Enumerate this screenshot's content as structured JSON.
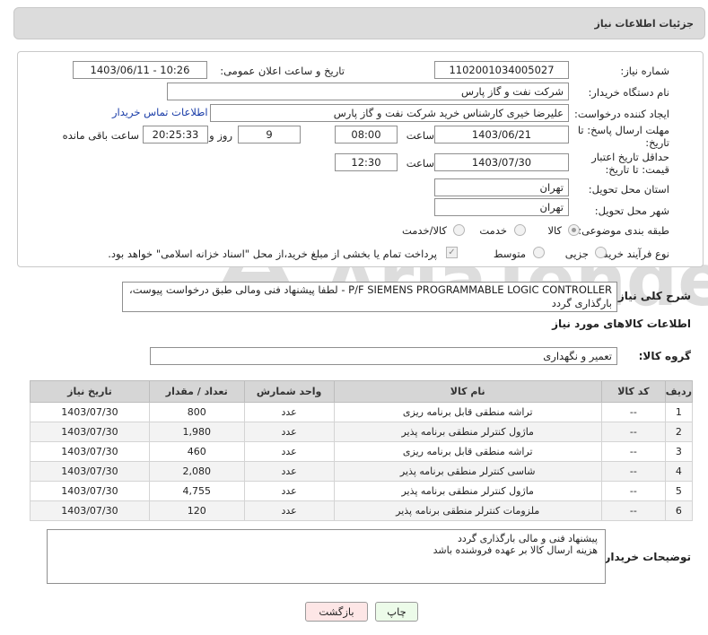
{
  "header": {
    "title": "جزئیات اطلاعات نیاز"
  },
  "form": {
    "need_number_label": "شماره نیاز:",
    "need_number": "1102001034005027",
    "announce_label": "تاریخ و ساعت اعلان عمومی:",
    "announce_value": "1403/06/11 - 10:26",
    "buyer_org_label": "نام دستگاه خریدار:",
    "buyer_org": "شرکت نفت و گاز پارس",
    "requester_label": "ایجاد کننده درخواست:",
    "requester": "علیرضا  خیری کارشناس خرید   شرکت نفت و گاز پارس",
    "contact_link": "اطلاعات تماس خریدار",
    "reply_deadline_label": "مهلت ارسال پاسخ: تا تاریخ:",
    "reply_date": "1403/06/21",
    "time_label": "ساعت",
    "reply_time": "08:00",
    "days_value": "9",
    "days_label": "روز و",
    "remaining_time": "20:25:33",
    "remaining_label": "ساعت باقی مانده",
    "price_validity_label": "حداقل تاریخ اعتبار قیمت: تا تاریخ:",
    "price_date": "1403/07/30",
    "price_time": "12:30",
    "province_label": "استان محل تحویل:",
    "province": "تهران",
    "city_label": "شهر محل تحویل:",
    "city": "تهران",
    "category_label": "طبقه بندی موضوعی:",
    "category_options": [
      "کالا",
      "خدمت",
      "کالا/خدمت"
    ],
    "process_label": "نوع فرآیند خرید :",
    "process_options": [
      "جزیی",
      "متوسط"
    ],
    "payment_note": "پرداخت تمام یا بخشی از مبلغ خرید،از محل \"اسناد خزانه اسلامی\" خواهد بود."
  },
  "summary": {
    "label": "شرح کلی نیاز:",
    "text": "P/F SIEMENS PROGRAMMABLE LOGIC CONTROLLER - لطفا پیشنهاد فنی ومالی طبق درخواست پیوست، بارگذاری گردد"
  },
  "goods_section": {
    "title": "اطلاعات کالاهای مورد نیاز",
    "group_label": "گروه کالا:",
    "group_value": "تعمیر و نگهداری"
  },
  "table": {
    "headers": [
      "ردیف",
      "کد کالا",
      "نام کالا",
      "واحد شمارش",
      "تعداد / مقدار",
      "تاریخ نیاز"
    ],
    "rows": [
      [
        "1",
        "--",
        "تراشه منطقی قابل برنامه ریزی",
        "عدد",
        "800",
        "1403/07/30"
      ],
      [
        "2",
        "--",
        "ماژول کنترلر منطقی برنامه پذیر",
        "عدد",
        "1,980",
        "1403/07/30"
      ],
      [
        "3",
        "--",
        "تراشه منطقی قابل برنامه ریزی",
        "عدد",
        "460",
        "1403/07/30"
      ],
      [
        "4",
        "--",
        "شاسی کنترلر منطقی برنامه پذیر",
        "عدد",
        "2,080",
        "1403/07/30"
      ],
      [
        "5",
        "--",
        "ماژول کنترلر منطقی برنامه پذیر",
        "عدد",
        "4,755",
        "1403/07/30"
      ],
      [
        "6",
        "--",
        "ملزومات کنترلر منطقی برنامه پذیر",
        "عدد",
        "120",
        "1403/07/30"
      ]
    ]
  },
  "buyer_notes": {
    "label": "توضیحات خریدار:",
    "line1": "پیشنهاد فنی و مالی بارگذاری گردد",
    "line2": "هزینه ارسال کالا بر عهده فروشنده باشد"
  },
  "buttons": {
    "print": "چاپ",
    "back": "بازگشت"
  },
  "watermark": "AriaTender.net"
}
